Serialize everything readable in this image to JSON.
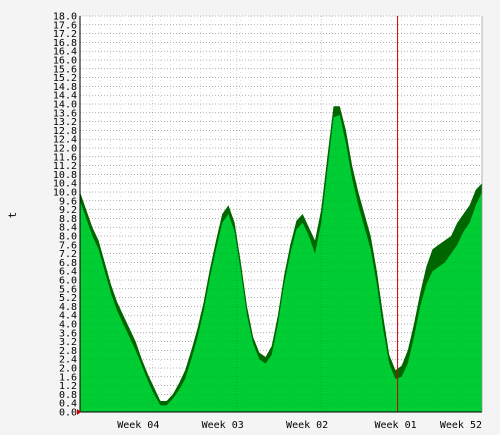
{
  "chart_data": {
    "type": "area",
    "ylabel": "t",
    "ylim": [
      0,
      18
    ],
    "grid": true,
    "y_ticks": [
      "0.0",
      "0.4",
      "0.8",
      "1.2",
      "1.6",
      "2.0",
      "2.4",
      "2.8",
      "3.2",
      "3.6",
      "4.0",
      "4.4",
      "4.8",
      "5.2",
      "5.6",
      "6.0",
      "6.4",
      "6.8",
      "7.2",
      "7.6",
      "8.0",
      "8.4",
      "8.8",
      "9.2",
      "9.6",
      "10.0",
      "10.4",
      "10.8",
      "11.2",
      "11.6",
      "12.0",
      "12.4",
      "12.8",
      "13.2",
      "13.6",
      "14.0",
      "14.4",
      "14.8",
      "15.2",
      "15.6",
      "16.0",
      "16.4",
      "16.8",
      "17.2",
      "17.6",
      "18.0"
    ],
    "x_ticks": [
      "Week 04",
      "Week 03",
      "Week 02",
      "Week 01",
      "Week 52"
    ],
    "colors": {
      "area_fill": "#00cc33",
      "max_band": "#006600",
      "current_marker": "#cc0000",
      "grid": "#999999"
    },
    "series": [
      {
        "values": [
          9.6,
          8.8,
          8.0,
          7.4,
          6.4,
          5.4,
          4.6,
          4.0,
          3.4,
          2.8,
          2.1,
          1.4,
          0.8,
          0.3,
          0.3,
          0.6,
          1.0,
          1.5,
          2.4,
          3.4,
          4.6,
          6.1,
          7.4,
          8.6,
          9.0,
          8.2,
          6.4,
          4.4,
          3.1,
          2.4,
          2.2,
          2.6,
          4.0,
          5.8,
          7.2,
          8.3,
          8.6,
          8.0,
          7.2,
          8.6,
          11.0,
          13.4,
          13.5,
          12.2,
          10.6,
          9.4,
          8.4,
          7.4,
          5.8,
          3.8,
          2.2,
          1.5,
          1.6,
          2.2,
          3.4,
          4.8,
          5.8,
          6.4,
          6.6,
          6.8,
          7.2,
          7.6,
          8.2,
          8.6,
          9.4,
          10.0
        ],
        "max": [
          10.0,
          9.2,
          8.4,
          7.8,
          6.8,
          5.8,
          5.0,
          4.4,
          3.8,
          3.2,
          2.4,
          1.7,
          1.1,
          0.5,
          0.5,
          0.8,
          1.3,
          1.9,
          2.8,
          3.8,
          5.0,
          6.5,
          7.8,
          9.0,
          9.4,
          8.6,
          6.8,
          4.8,
          3.4,
          2.7,
          2.5,
          3.0,
          4.4,
          6.2,
          7.6,
          8.7,
          9.0,
          8.4,
          7.8,
          9.2,
          11.6,
          13.9,
          13.9,
          12.8,
          11.2,
          10.0,
          9.0,
          8.0,
          6.4,
          4.4,
          2.6,
          1.9,
          2.1,
          2.8,
          4.0,
          5.4,
          6.6,
          7.4,
          7.6,
          7.8,
          8.0,
          8.6,
          9.0,
          9.4,
          10.1,
          10.4
        ]
      }
    ]
  }
}
